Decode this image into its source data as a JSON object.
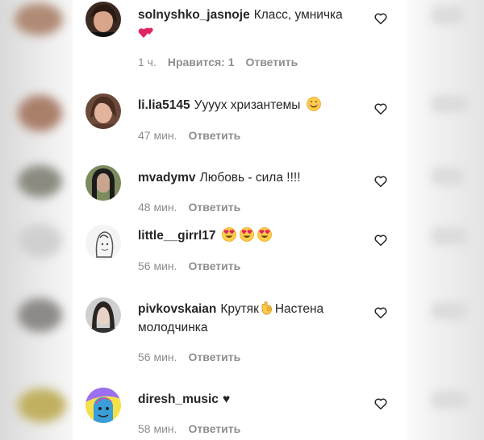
{
  "comments": [
    {
      "username": "solnyshko_jasnoje",
      "text": "Класс, умничка",
      "time": "1 ч.",
      "likes": "Нравится: 1",
      "reply": "Ответить"
    },
    {
      "username": "li.lia5145",
      "text": "Уууух хризантемы",
      "time": "47 мин.",
      "reply": "Ответить"
    },
    {
      "username": "mvadymv",
      "text": "Любовь - сила !!!!",
      "time": "48 мин.",
      "reply": "Ответить"
    },
    {
      "username": "little__girrl17",
      "text": "",
      "time": "56 мин.",
      "reply": "Ответить"
    },
    {
      "username": "pivkovskaian",
      "text": "Крутяк",
      "text2": "Настена",
      "text3": "молодчинка",
      "time": "56 мин.",
      "reply": "Ответить"
    },
    {
      "username": "diresh_music",
      "text": "♥",
      "time": "58 мин.",
      "reply": "Ответить"
    }
  ],
  "icons": {
    "heart": "heart-outline-icon",
    "emoji_hearts": "two-hearts-emoji",
    "emoji_smile": "smiling-face-emoji",
    "emoji_heart_eyes": "heart-eyes-emoji",
    "emoji_ok": "ok-hand-emoji"
  },
  "colors": {
    "username": "#262626",
    "meta": "#8e8e8e",
    "heart_stroke": "#262626"
  }
}
